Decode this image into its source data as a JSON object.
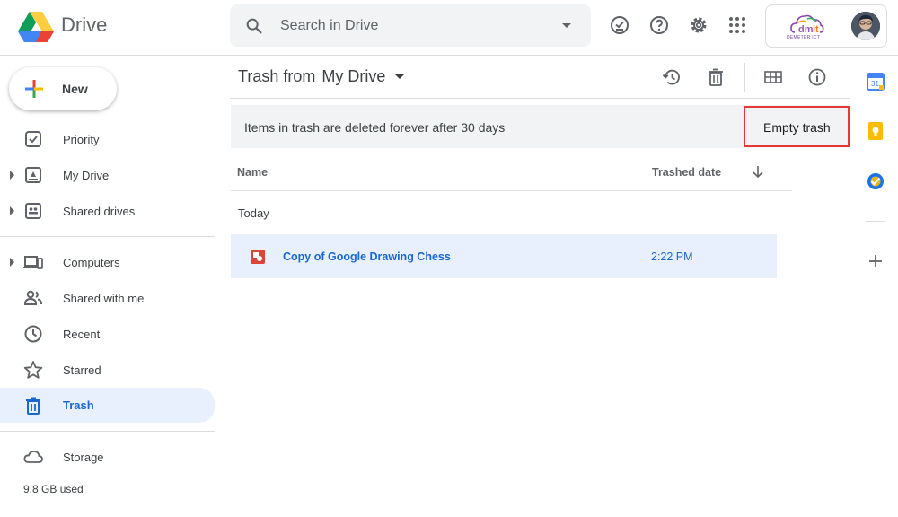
{
  "header": {
    "app_name": "Drive",
    "search_placeholder": "Search in Drive",
    "org_name": "DEMETER ICT"
  },
  "sidebar": {
    "new_label": "New",
    "items": [
      {
        "label": "Priority",
        "icon": "priority-icon"
      },
      {
        "label": "My Drive",
        "icon": "my-drive-icon"
      },
      {
        "label": "Shared drives",
        "icon": "shared-drives-icon"
      },
      {
        "label": "Computers",
        "icon": "computers-icon"
      },
      {
        "label": "Shared with me",
        "icon": "shared-with-me-icon"
      },
      {
        "label": "Recent",
        "icon": "recent-icon"
      },
      {
        "label": "Starred",
        "icon": "star-icon"
      },
      {
        "label": "Trash",
        "icon": "trash-icon",
        "active": true
      },
      {
        "label": "Storage",
        "icon": "cloud-icon"
      }
    ],
    "storage_used": "9.8 GB used"
  },
  "main": {
    "breadcrumb_prefix": "Trash from",
    "breadcrumb_location": "My Drive",
    "banner_message": "Items in trash are deleted forever after 30 days",
    "empty_trash_label": "Empty trash",
    "columns": {
      "name": "Name",
      "trashed_date": "Trashed date"
    },
    "group_label": "Today",
    "files": [
      {
        "name": "Copy of Google Drawing Chess",
        "trashed_date": "2:22 PM",
        "icon": "google-drawing-icon"
      }
    ]
  },
  "colors": {
    "accent": "#1967d2",
    "active_bg": "#e8f0fe",
    "highlight_border": "#e53935",
    "banner_bg": "#f1f3f4"
  }
}
